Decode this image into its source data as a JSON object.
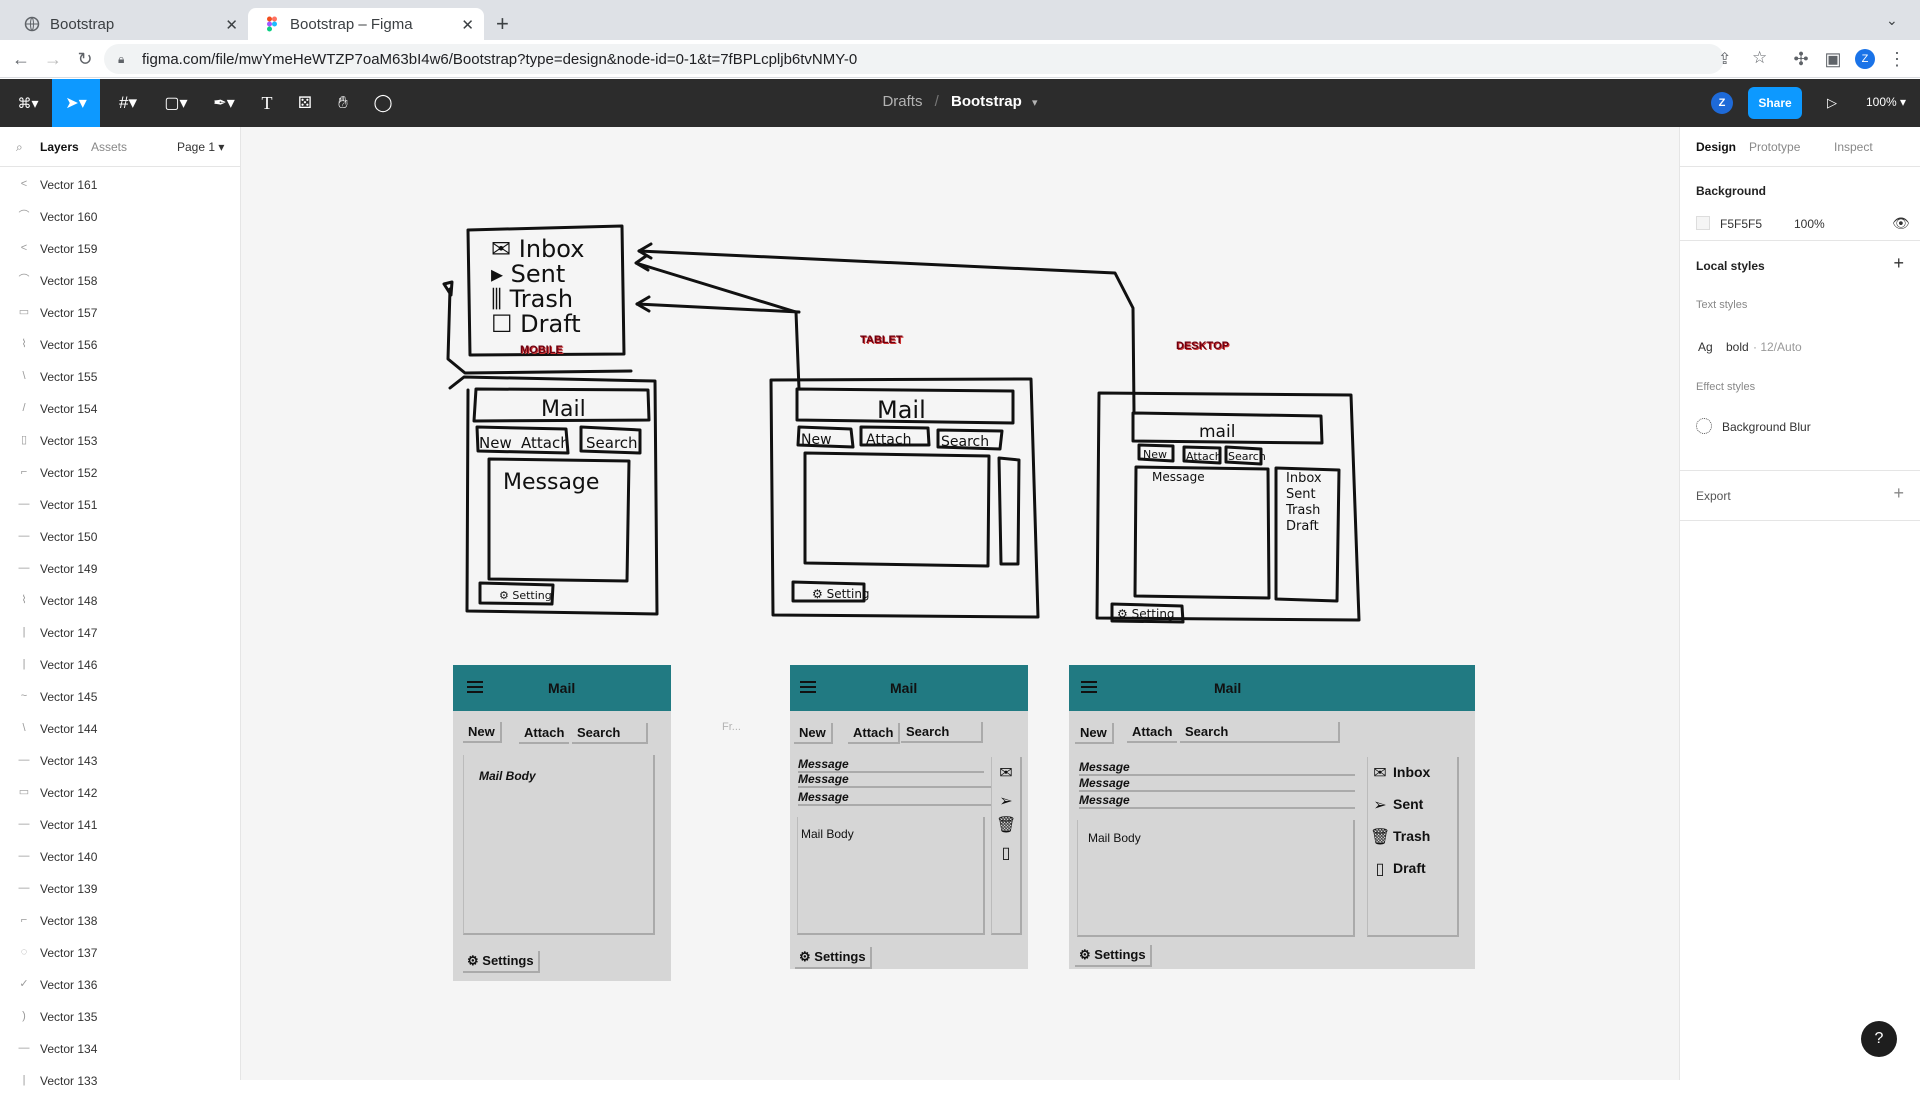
{
  "browser": {
    "tabs": [
      {
        "title": "Bootstrap",
        "active": false
      },
      {
        "title": "Bootstrap – Figma",
        "active": true
      }
    ],
    "url": "figma.com/file/mwYmeHeWTZP7oaM63bI4w6/Bootstrap?type=design&node-id=0-1&t=7fBPLcpljb6tvNMY-0",
    "profile_initial": "Z"
  },
  "toolbar": {
    "breadcrumb_parent": "Drafts",
    "breadcrumb_sep": "/",
    "file_name": "Bootstrap",
    "share_label": "Share",
    "zoom": "100%",
    "avatar_initial": "Z"
  },
  "left_panel": {
    "tabs": [
      "Layers",
      "Assets"
    ],
    "page": "Page 1",
    "layers": [
      {
        "name": "Vector 161",
        "icon": "<"
      },
      {
        "name": "Vector 160",
        "icon": "⌒"
      },
      {
        "name": "Vector 159",
        "icon": "<"
      },
      {
        "name": "Vector 158",
        "icon": "⌒"
      },
      {
        "name": "Vector 157",
        "icon": "▭"
      },
      {
        "name": "Vector 156",
        "icon": "⌇"
      },
      {
        "name": "Vector 155",
        "icon": "\\"
      },
      {
        "name": "Vector 154",
        "icon": "/"
      },
      {
        "name": "Vector 153",
        "icon": "▯"
      },
      {
        "name": "Vector 152",
        "icon": "⌐"
      },
      {
        "name": "Vector 151",
        "icon": "—"
      },
      {
        "name": "Vector 150",
        "icon": "—"
      },
      {
        "name": "Vector 149",
        "icon": "—"
      },
      {
        "name": "Vector 148",
        "icon": "⌇"
      },
      {
        "name": "Vector 147",
        "icon": "|"
      },
      {
        "name": "Vector 146",
        "icon": "|"
      },
      {
        "name": "Vector 145",
        "icon": "~"
      },
      {
        "name": "Vector 144",
        "icon": "\\"
      },
      {
        "name": "Vector 143",
        "icon": "—"
      },
      {
        "name": "Vector 142",
        "icon": "▭"
      },
      {
        "name": "Vector 141",
        "icon": "—"
      },
      {
        "name": "Vector 140",
        "icon": "—"
      },
      {
        "name": "Vector 139",
        "icon": "—"
      },
      {
        "name": "Vector 138",
        "icon": "⌐"
      },
      {
        "name": "Vector 137",
        "icon": "◌"
      },
      {
        "name": "Vector 136",
        "icon": "✓"
      },
      {
        "name": "Vector 135",
        "icon": ")"
      },
      {
        "name": "Vector 134",
        "icon": "—"
      },
      {
        "name": "Vector 133",
        "icon": "|"
      }
    ]
  },
  "right_panel": {
    "tabs": [
      "Design",
      "Prototype",
      "Inspect"
    ],
    "background_title": "Background",
    "background_hex": "F5F5F5",
    "background_opacity": "100%",
    "local_styles_title": "Local styles",
    "text_styles_title": "Text styles",
    "text_style_sample": "Ag",
    "text_style_name": "bold",
    "text_style_spec": "· 12/Auto",
    "effect_styles_title": "Effect styles",
    "effect_style_name": "Background Blur",
    "export_title": "Export"
  },
  "sketches": {
    "mobile_label": "MOBILE",
    "tablet_label": "TABLET",
    "desktop_label": "DESKTOP",
    "menu_items": [
      "Inbox",
      "Sent",
      "Trash",
      "Draft"
    ],
    "title": "Mail",
    "buttons": [
      "New",
      "Attach",
      "Search"
    ],
    "message": "Message",
    "setting": "Setting"
  },
  "mockups": {
    "title": "Mail",
    "buttons": [
      "New",
      "Attach",
      "Search"
    ],
    "message_label": "Message",
    "body_label": "Mail Body",
    "settings_label": "Settings",
    "nav": [
      "Inbox",
      "Sent",
      "Trash",
      "Draft"
    ],
    "frame_hint": "Fr..."
  },
  "colors": {
    "figma_blue": "#0d99ff",
    "header_teal": "#217a82",
    "canvas": "#f5f5f5",
    "mock_grey": "#d6d6d6"
  }
}
